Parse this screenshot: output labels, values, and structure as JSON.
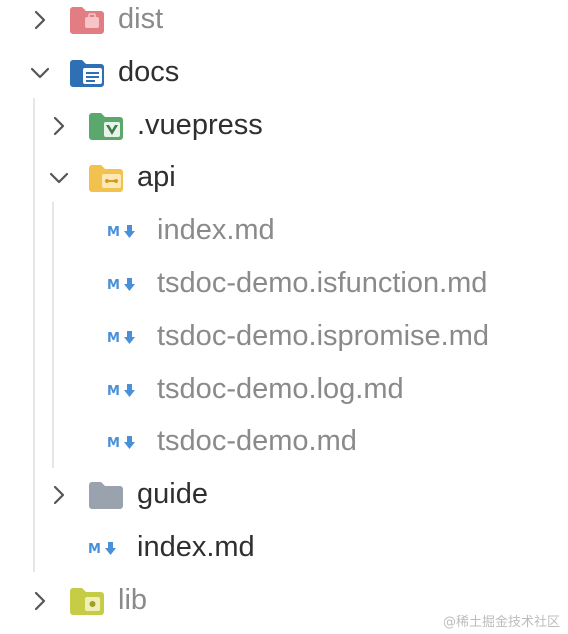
{
  "tree": {
    "dist": {
      "label": "dist",
      "chevron": "chevron-right-icon",
      "icon": "folder-dist-icon"
    },
    "docs": {
      "label": "docs",
      "chevron": "chevron-down-icon",
      "icon": "folder-docs-icon"
    },
    "vuepress": {
      "label": ".vuepress",
      "chevron": "chevron-right-icon",
      "icon": "folder-vuepress-icon"
    },
    "api": {
      "label": "api",
      "chevron": "chevron-down-icon",
      "icon": "folder-api-icon"
    },
    "api_files": [
      {
        "label": "index.md",
        "icon": "markdown-icon"
      },
      {
        "label": "tsdoc-demo.isfunction.md",
        "icon": "markdown-icon"
      },
      {
        "label": "tsdoc-demo.ispromise.md",
        "icon": "markdown-icon"
      },
      {
        "label": "tsdoc-demo.log.md",
        "icon": "markdown-icon"
      },
      {
        "label": "tsdoc-demo.md",
        "icon": "markdown-icon"
      }
    ],
    "guide": {
      "label": "guide",
      "chevron": "chevron-right-icon",
      "icon": "folder-guide-icon"
    },
    "docs_index": {
      "label": "index.md",
      "icon": "markdown-icon"
    },
    "lib": {
      "label": "lib",
      "chevron": "chevron-right-icon",
      "icon": "folder-lib-icon"
    }
  },
  "watermark": "@稀土掘金技术社区",
  "colors": {
    "dist_folder": "#e06c75",
    "docs_folder": "#2f6fb3",
    "vuepress_folder": "#5aa86b",
    "api_folder": "#f2c14e",
    "guide_folder": "#9aa3ad",
    "lib_folder": "#c7cc46",
    "markdown": "#4a90d9"
  }
}
